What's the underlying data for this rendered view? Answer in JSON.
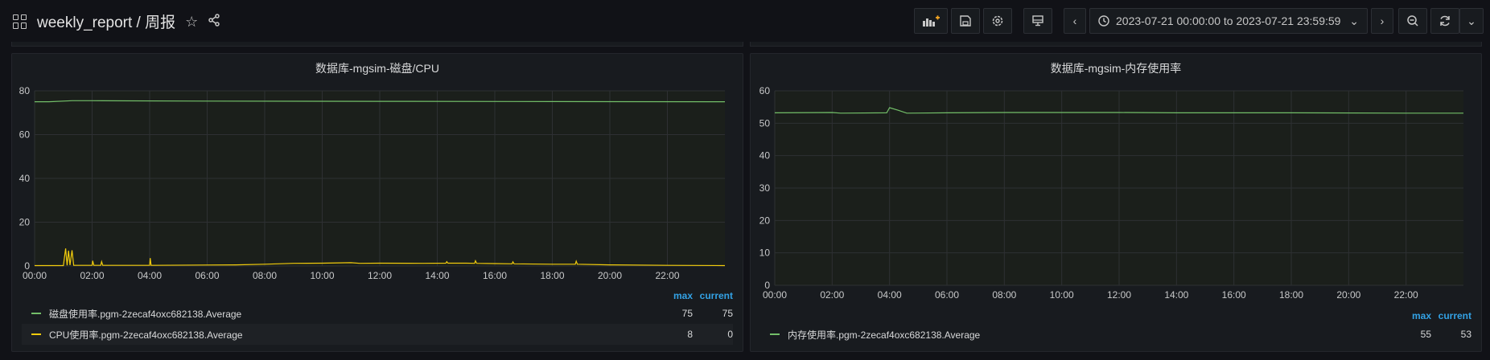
{
  "header": {
    "title": "weekly_report / 周报",
    "time_range": "2023-07-21 00:00:00 to 2023-07-21 23:59:59"
  },
  "colors": {
    "green": "#73bf69",
    "yellow": "#f2cc0c",
    "accent": "#33a2e5"
  },
  "panels": [
    {
      "title": "数据库-mgsim-磁盘/CPU",
      "legend_headers": [
        "max",
        "current"
      ],
      "legend": [
        {
          "name": "磁盘使用率.pgm-2zecaf4oxc682138.Average",
          "max": "75",
          "current": "75",
          "color": "#73bf69"
        },
        {
          "name": "CPU使用率.pgm-2zecaf4oxc682138.Average",
          "max": "8",
          "current": "0",
          "color": "#f2cc0c"
        }
      ]
    },
    {
      "title": "数据库-mgsim-内存使用率",
      "legend_headers": [
        "max",
        "current"
      ],
      "legend": [
        {
          "name": "内存使用率.pgm-2zecaf4oxc682138.Average",
          "max": "55",
          "current": "53",
          "color": "#73bf69"
        }
      ]
    }
  ],
  "chart_data": [
    {
      "type": "line",
      "title": "数据库-mgsim-磁盘/CPU",
      "x_ticks": [
        "00:00",
        "02:00",
        "04:00",
        "06:00",
        "08:00",
        "10:00",
        "12:00",
        "14:00",
        "16:00",
        "18:00",
        "20:00",
        "22:00"
      ],
      "y_ticks": [
        0,
        20,
        40,
        60,
        80
      ],
      "ylim": [
        0,
        80
      ],
      "xlim_hours": [
        0,
        24
      ],
      "grid": true,
      "legend_position": "bottom",
      "series": [
        {
          "name": "磁盘使用率.pgm-2zecaf4oxc682138.Average",
          "color": "#73bf69",
          "points": [
            [
              0,
              75
            ],
            [
              0.5,
              75
            ],
            [
              1.3,
              75.5
            ],
            [
              2,
              75.5
            ],
            [
              6,
              75.3
            ],
            [
              12,
              75.2
            ],
            [
              18,
              75.1
            ],
            [
              24,
              75
            ]
          ]
        },
        {
          "name": "CPU使用率.pgm-2zecaf4oxc682138.Average",
          "color": "#f2cc0c",
          "points": [
            [
              0,
              0.2
            ],
            [
              1.0,
              0.2
            ],
            [
              1.08,
              8
            ],
            [
              1.13,
              0.3
            ],
            [
              1.18,
              7
            ],
            [
              1.23,
              0.4
            ],
            [
              1.3,
              7.2
            ],
            [
              1.36,
              0.3
            ],
            [
              2,
              0.3
            ],
            [
              2.02,
              2.4
            ],
            [
              2.06,
              0.3
            ],
            [
              2.3,
              0.3
            ],
            [
              2.33,
              2.0
            ],
            [
              2.37,
              0.3
            ],
            [
              4,
              0.3
            ],
            [
              4.02,
              3.6
            ],
            [
              4.05,
              0.3
            ],
            [
              7,
              0.5
            ],
            [
              8,
              0.8
            ],
            [
              9,
              1.2
            ],
            [
              10,
              1.3
            ],
            [
              11,
              1.5
            ],
            [
              11.3,
              1.2
            ],
            [
              12,
              1.3
            ],
            [
              13.5,
              1.2
            ],
            [
              14.3,
              1.3
            ],
            [
              14.33,
              2.0
            ],
            [
              14.37,
              1.3
            ],
            [
              15,
              1.3
            ],
            [
              15.3,
              1.2
            ],
            [
              15.33,
              2.4
            ],
            [
              15.37,
              1.2
            ],
            [
              16,
              1.1
            ],
            [
              16.6,
              1.0
            ],
            [
              16.63,
              1.9
            ],
            [
              16.67,
              1.0
            ],
            [
              18,
              0.8
            ],
            [
              18.8,
              0.8
            ],
            [
              18.83,
              2.2
            ],
            [
              18.87,
              0.8
            ],
            [
              20,
              0.5
            ],
            [
              22,
              0.3
            ],
            [
              24,
              0.2
            ]
          ]
        }
      ]
    },
    {
      "type": "line",
      "title": "数据库-mgsim-内存使用率",
      "x_ticks": [
        "00:00",
        "02:00",
        "04:00",
        "06:00",
        "08:00",
        "10:00",
        "12:00",
        "14:00",
        "16:00",
        "18:00",
        "20:00",
        "22:00"
      ],
      "y_ticks": [
        0,
        10,
        20,
        30,
        40,
        50,
        60
      ],
      "ylim": [
        0,
        60
      ],
      "xlim_hours": [
        0,
        24
      ],
      "grid": true,
      "legend_position": "bottom",
      "series": [
        {
          "name": "内存使用率.pgm-2zecaf4oxc682138.Average",
          "color": "#73bf69",
          "points": [
            [
              0,
              53.2
            ],
            [
              2,
              53.3
            ],
            [
              2.3,
              53.1
            ],
            [
              3.9,
              53.2
            ],
            [
              4.0,
              54.8
            ],
            [
              4.3,
              54.0
            ],
            [
              4.6,
              53.1
            ],
            [
              6,
              53.2
            ],
            [
              8,
              53.3
            ],
            [
              10,
              53.3
            ],
            [
              12,
              53.3
            ],
            [
              14,
              53.2
            ],
            [
              18,
              53.2
            ],
            [
              22,
              53.1
            ],
            [
              24,
              53.1
            ]
          ]
        }
      ]
    }
  ]
}
